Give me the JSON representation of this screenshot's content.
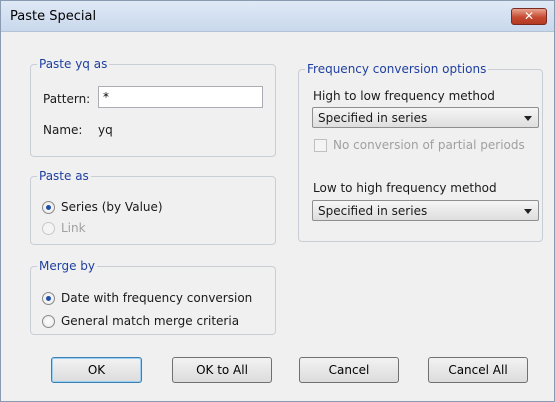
{
  "window": {
    "title": "Paste Special",
    "close_label": "✕"
  },
  "paste_as_group": {
    "legend": "Paste yq as",
    "pattern_label": "Pattern:",
    "pattern_value": "*",
    "name_label": "Name:",
    "name_value": "yq"
  },
  "paste_type_group": {
    "legend": "Paste as",
    "options": [
      {
        "label": "Series (by Value)",
        "checked": true,
        "enabled": true
      },
      {
        "label": "Link",
        "checked": false,
        "enabled": false
      }
    ]
  },
  "merge_group": {
    "legend": "Merge by",
    "options": [
      {
        "label": "Date with frequency conversion",
        "checked": true
      },
      {
        "label": "General match merge criteria",
        "checked": false
      }
    ]
  },
  "freq_group": {
    "legend": "Frequency conversion options",
    "high_to_low_label": "High to low frequency method",
    "high_to_low_value": "Specified in series",
    "no_partial_label": "No conversion of partial periods",
    "low_to_high_label": "Low to high frequency method",
    "low_to_high_value": "Specified in series"
  },
  "buttons": {
    "ok": "OK",
    "ok_all": "OK to All",
    "cancel": "Cancel",
    "cancel_all": "Cancel All"
  }
}
